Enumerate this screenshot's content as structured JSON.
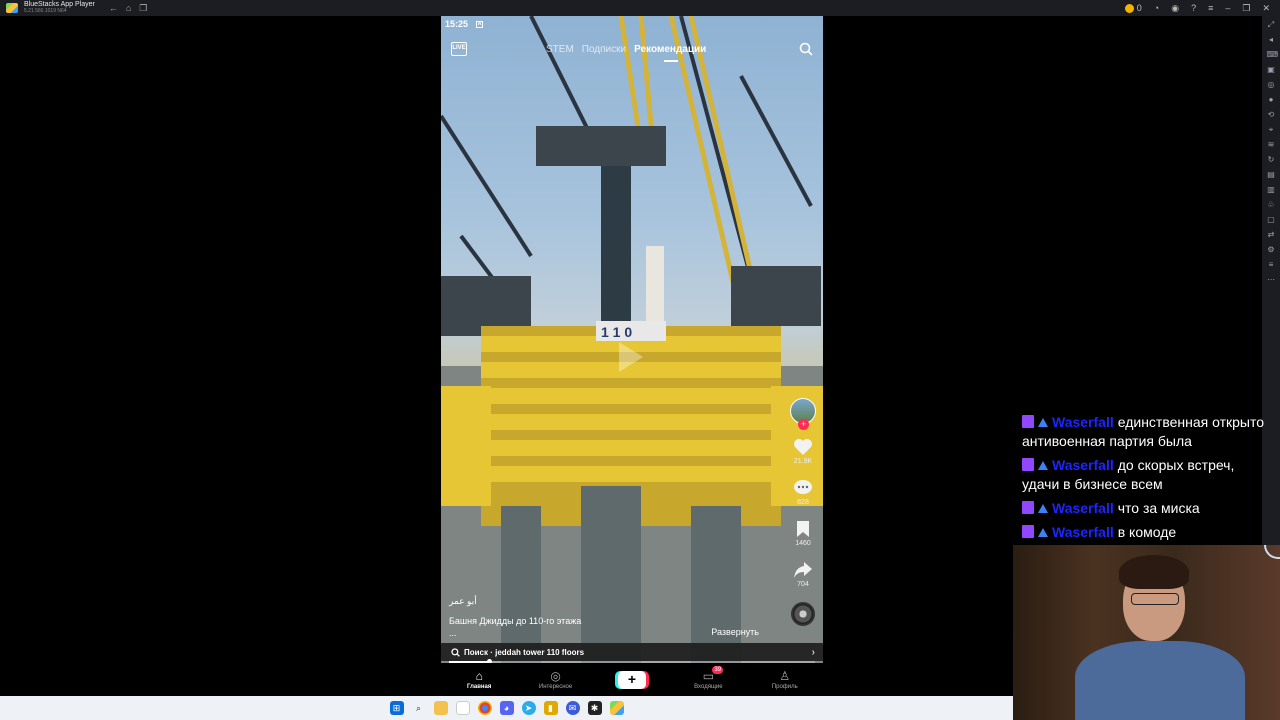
{
  "window": {
    "title": "BlueStacks App Player",
    "subtitle": "5.21.560.1019 N64",
    "coin_count": "0"
  },
  "phone": {
    "time": "15:25",
    "live_label": "LIVE",
    "tabs": [
      {
        "label": "STEM",
        "active": false
      },
      {
        "label": "Подписки",
        "active": false
      },
      {
        "label": "Рекомендации",
        "active": true
      }
    ],
    "building_number": "1 1 0",
    "rail": {
      "likes": "21.9K",
      "comments": "828",
      "saves": "1460",
      "shares": "704"
    },
    "author": "أبو عمر",
    "description": "Башня Джидды до 110-го этажа",
    "description_more": "...",
    "expand_label": "Развернуть",
    "search_suggestion": "Поиск · jeddah tower 110 floors",
    "progress": 0.11,
    "bottom_nav": [
      {
        "label": "Главная",
        "active": true
      },
      {
        "label": "Интересное",
        "active": false
      },
      {
        "label": "",
        "active": false
      },
      {
        "label": "Входящие",
        "active": false
      },
      {
        "label": "Профиль",
        "active": false
      }
    ],
    "inbox_badge": "39"
  },
  "chat": [
    {
      "user": "Waserfall",
      "text": "единственная открыто антивоенная партия была"
    },
    {
      "user": "Waserfall",
      "text": "до скорых встреч, удачи в бизнесе всем"
    },
    {
      "user": "Waserfall",
      "text": "что за миска"
    },
    {
      "user": "Waserfall",
      "text": "в комоде"
    }
  ],
  "colors": {
    "accent_pink": "#fe2c55",
    "accent_cyan": "#25f4ee",
    "twitch_purple": "#9146ff",
    "chat_user": "#1d24ff"
  }
}
